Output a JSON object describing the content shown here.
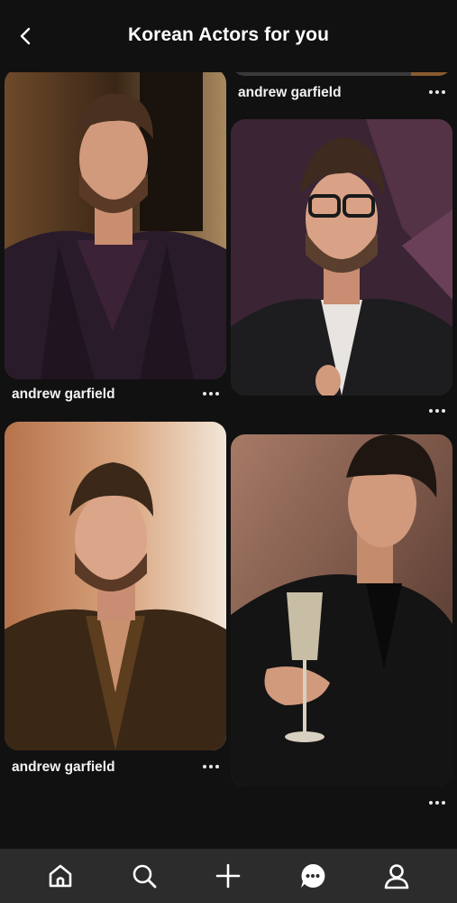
{
  "header": {
    "title": "Korean Actors for you",
    "back_icon": "chevron-left-icon"
  },
  "pins": [
    {
      "caption": "andrew garfield",
      "more_icon": "more-dots-icon"
    },
    {
      "caption": "andrew garfield",
      "more_icon": "more-dots-icon"
    },
    {
      "caption": "",
      "more_icon": "more-dots-icon"
    },
    {
      "caption": "andrew garfield",
      "more_icon": "more-dots-icon"
    },
    {
      "caption": "",
      "more_icon": "more-dots-icon"
    }
  ],
  "tabbar": {
    "items": [
      "home-icon",
      "search-icon",
      "create-plus-icon",
      "messages-icon",
      "profile-icon"
    ]
  },
  "colors": {
    "background": "#111111",
    "tabbar": "#2c2c2c",
    "text": "#ffffff"
  }
}
